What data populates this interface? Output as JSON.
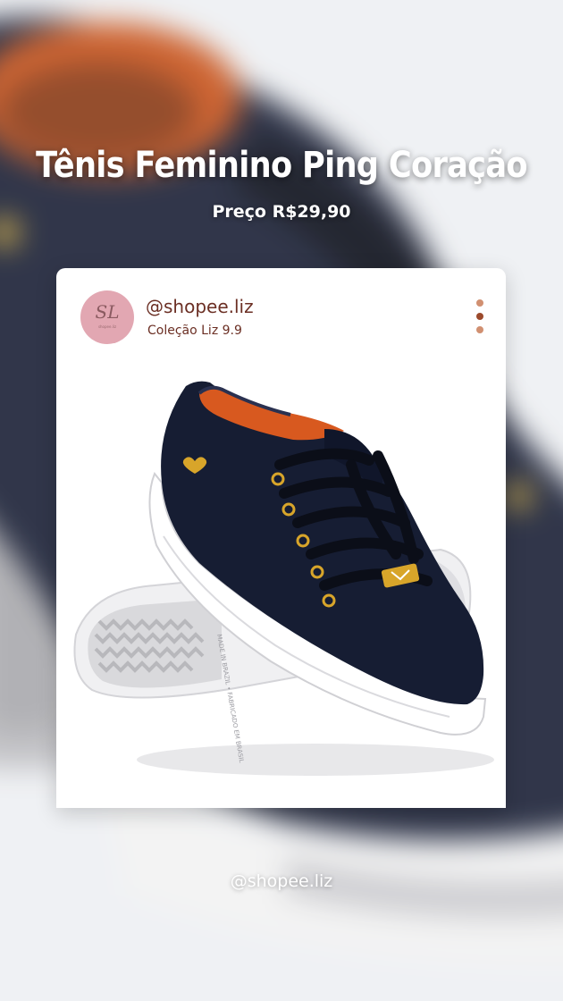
{
  "post": {
    "title": "Tênis Feminino Ping Coração",
    "price": "Preço R$29,90"
  },
  "card": {
    "avatar_monogram": "SL",
    "avatar_caption": "shopee.liz",
    "username": "@shopee.liz",
    "collection": "Coleção Liz 9.9",
    "menu_icon": "more-vertical-icon",
    "menu_dot_colors": [
      "#d19071",
      "#9c4a2c",
      "#d19071"
    ],
    "product_image": "navy-velvet-sneaker-white-sole",
    "sole_text": "MADE IN BRAZIL • FABRICADO EM BRASIL"
  },
  "footer": {
    "handle": "@shopee.liz"
  },
  "colors": {
    "accent_brown": "#6b2f24",
    "avatar_pink": "#e2a7b2",
    "shoe_navy": "#161d33",
    "lining_orange": "#d8591f",
    "eyelet_gold": "#d8a52a"
  }
}
